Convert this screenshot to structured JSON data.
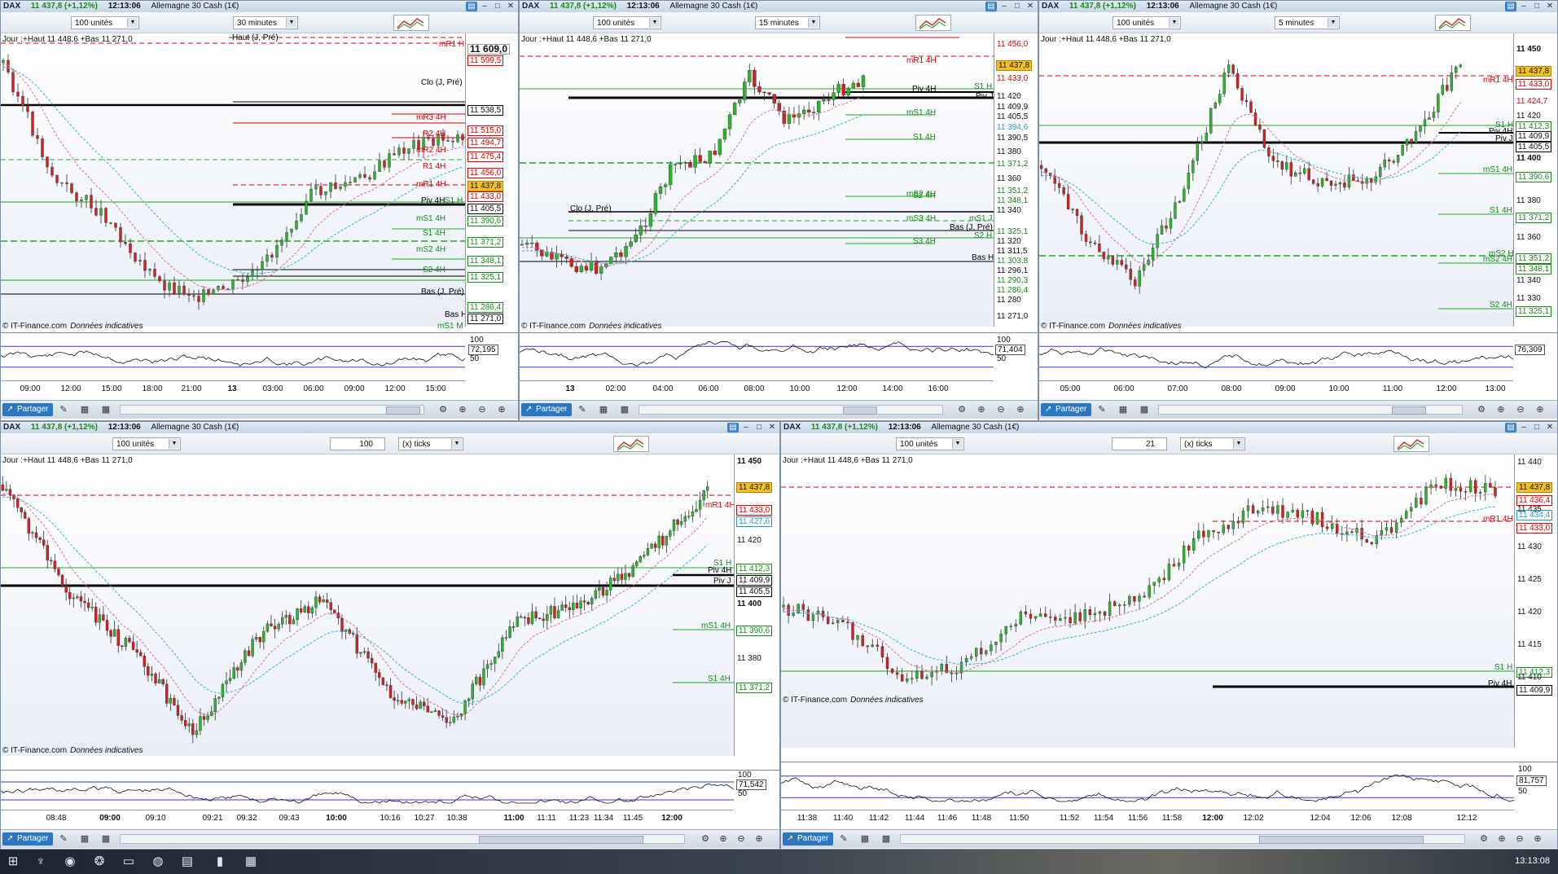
{
  "common": {
    "symbol": "DAX",
    "price_change": "11 437,8 (+1,12%)",
    "time": "12:13:06",
    "instrument": "Allemagne 30 Cash (1€)",
    "qty": "100 unités",
    "info": "Jour :+Haut 11 448,6 +Bas 11 271,0",
    "copyright": "© IT-Finance.com",
    "disclaimer": "Données indicatives",
    "share": "Partager",
    "osc_top": "100",
    "osc_mid": "50"
  },
  "windows": [
    {
      "id": "w1",
      "timeframe": "30 minutes",
      "y_labels": [
        "11 609,0",
        "11 599,5",
        "11 538,5",
        "11 515,0",
        "11 494,7",
        "11 475,4",
        "11 456,0",
        "11 437,8",
        "11 433,0",
        "11 405,5",
        "11 390,6",
        "11 371,2",
        "11 348,1",
        "11 325,1",
        "11 286,4",
        "11 271,0"
      ],
      "x_labels": [
        "09:00",
        "12:00",
        "15:00",
        "18:00",
        "21:00",
        "13",
        "03:00",
        "06:00",
        "09:00",
        "12:00",
        "15:00"
      ],
      "levels": [
        "Haut (J, Pré)",
        "mR1 H",
        "Clo (J, Pré)",
        "mR3 4H",
        "R2 4H",
        "mR2 4H",
        "R1 4H",
        "mR1 4H",
        "S1 H",
        "Piv 4H",
        "mS1 4H",
        "S1 4H",
        "mS2 4H",
        "S2 4H",
        "Bas (J, Pré)",
        "Bas H",
        "mS1 M"
      ],
      "osc_value": "72,195"
    },
    {
      "id": "w2",
      "timeframe": "15 minutes",
      "y_labels": [
        "11 456,0",
        "11 437,8",
        "11 433,0",
        "11 420",
        "11 409,9",
        "11 405,5",
        "11 394,6",
        "11 390,5",
        "11 380",
        "11 371,2",
        "11 360",
        "11 351,2",
        "11 348,1",
        "11 340",
        "11 325,1",
        "11 320",
        "11 311,5",
        "11 303,8",
        "11 296,1",
        "11 290,3",
        "11 286,4",
        "11 280",
        "11 271,0"
      ],
      "x_labels": [
        "13",
        "02:00",
        "04:00",
        "06:00",
        "08:00",
        "10:00",
        "12:00",
        "14:00",
        "16:00"
      ],
      "levels": [
        "mR1 4H",
        "S1 H",
        "Piv 4H",
        "Piv J",
        "mS1 4H",
        "S1 4H",
        "mS2 4H",
        "S2 4H",
        "Clo (J, Pré)",
        "mS3 4H",
        "mS1 J",
        "Bas (J, Pré)",
        "S2 H",
        "S3 4H",
        "Bas H"
      ],
      "osc_value": "71,404"
    },
    {
      "id": "w3",
      "timeframe": "5 minutes",
      "y_labels": [
        "11 450",
        "11 437,8",
        "11 433,0",
        "11 424,7",
        "11 420",
        "11 412,3",
        "11 409,9",
        "11 405,5",
        "11 400",
        "11 390,6",
        "11 380",
        "11 371,2",
        "11 360",
        "11 351,2",
        "11 348,1",
        "11 340",
        "11 330",
        "11 325,1"
      ],
      "x_labels": [
        "05:00",
        "06:00",
        "07:00",
        "08:00",
        "09:00",
        "10:00",
        "11:00",
        "12:00",
        "13:00"
      ],
      "levels": [
        "mR1 4H",
        "S1 H",
        "Piv 4H",
        "Piv J",
        "mS1 4H",
        "S1 4H",
        "mS2 H",
        "mS2 4H",
        "S2 4H"
      ],
      "osc_value": "76,309"
    },
    {
      "id": "w4",
      "ticks": "100",
      "ticks_unit": "(x) ticks",
      "y_labels": [
        "11 450",
        "11 437,8",
        "11 433,0",
        "11 427,6",
        "11 420",
        "11 412,3",
        "11 409,9",
        "11 405,5",
        "11 400",
        "11 390,6",
        "11 380",
        "11 371,2"
      ],
      "x_labels": [
        "08:48",
        "09:00",
        "09:10",
        "09:21",
        "09:32",
        "09:43",
        "10:00",
        "10:16",
        "10:27",
        "10:38",
        "11:00",
        "11:11",
        "11:23",
        "11:34",
        "11:45",
        "12:00"
      ],
      "levels": [
        "mR1 4H",
        "S1 H",
        "Piv 4H",
        "Piv J",
        "mS1 4H",
        "S1 4H"
      ],
      "osc_value": "71,542"
    },
    {
      "id": "w5",
      "ticks": "21",
      "ticks_unit": "(x) ticks",
      "y_labels": [
        "11 440",
        "11 437,8",
        "11 436,4",
        "11 435",
        "11 434,4",
        "11 433,0",
        "11 430",
        "11 425",
        "11 420",
        "11 415",
        "11 412,3",
        "11 410",
        "11 409,9"
      ],
      "x_labels": [
        "11:38",
        "11:40",
        "11:42",
        "11:44",
        "11:46",
        "11:48",
        "11:50",
        "11:52",
        "11:54",
        "11:56",
        "11:58",
        "12:00",
        "12:02",
        "12:04",
        "12:06",
        "12:08",
        "12:12"
      ],
      "levels": [
        "mR1 4H",
        "S1 H",
        "Piv 4H"
      ],
      "osc_value": "81,757"
    }
  ],
  "taskbar": {
    "clock": "13:13:08"
  }
}
